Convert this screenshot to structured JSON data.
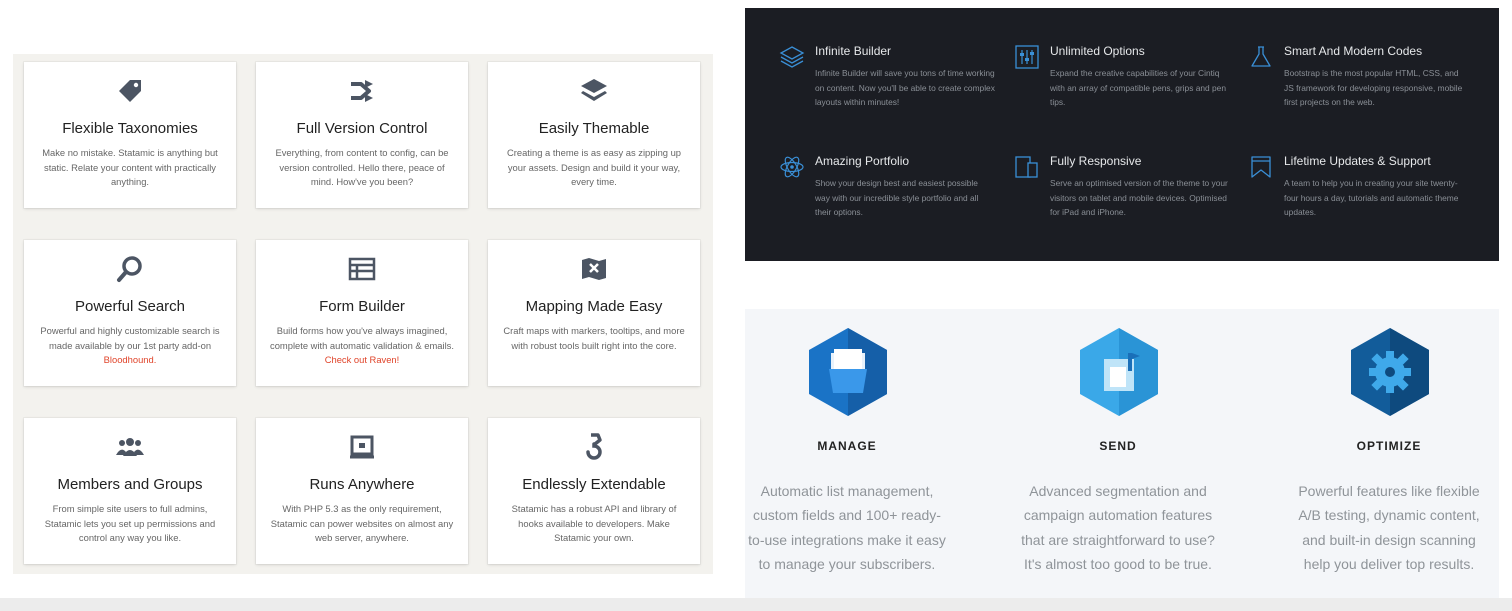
{
  "features_grid": [
    {
      "title": "Flexible Taxonomies",
      "desc": "Make no mistake. Statamic is anything but static. Relate your content with practically anything.",
      "link": "",
      "icon": "tag-icon"
    },
    {
      "title": "Full Version Control",
      "desc": "Everything, from content to config, can be version controlled. Hello there, peace of mind. How've you been?",
      "link": "",
      "icon": "branch-icon"
    },
    {
      "title": "Easily Themable",
      "desc": "Creating a theme is as easy as zipping up your assets. Design and build it your way, every time.",
      "link": "",
      "icon": "layers-icon"
    },
    {
      "title": "Powerful Search",
      "desc": "Powerful and highly customizable search is made available by our 1st party add-on",
      "link": "Bloodhound.",
      "icon": "search-icon"
    },
    {
      "title": "Form Builder",
      "desc": "Build forms how you've always imagined, complete with automatic validation & emails.",
      "link": "Check out Raven!",
      "icon": "form-icon"
    },
    {
      "title": "Mapping Made Easy",
      "desc": "Craft maps with markers, tooltips, and more with robust tools built right into the core.",
      "link": "",
      "icon": "map-icon"
    },
    {
      "title": "Members and Groups",
      "desc": "From simple site users to full admins, Statamic lets you set up permissions and control any way you like.",
      "link": "",
      "icon": "users-icon"
    },
    {
      "title": "Runs Anywhere",
      "desc": "With PHP 5.3 as the only requirement, Statamic can power websites on almost any web server, anywhere.",
      "link": "",
      "icon": "server-icon"
    },
    {
      "title": "Endlessly Extendable",
      "desc": "Statamic has a robust API and library of hooks available to developers. Make Statamic your own.",
      "link": "",
      "icon": "hook-icon"
    }
  ],
  "dark_features": [
    {
      "title": "Infinite Builder",
      "desc": "Infinite Builder will save you tons of time working on content. Now you'll be able to create complex layouts within minutes!",
      "icon": "stack-icon"
    },
    {
      "title": "Unlimited Options",
      "desc": "Expand the creative capabilities of your Cintiq with an array of compatible pens, grips and pen tips.",
      "icon": "sliders-icon"
    },
    {
      "title": "Smart And Modern Codes",
      "desc": "Bootstrap is the most popular HTML, CSS, and JS framework for developing responsive, mobile first projects on the web.",
      "icon": "flask-icon"
    },
    {
      "title": "Amazing Portfolio",
      "desc": "Show your design best and easiest possible way with our incredible style portfolio and all their options.",
      "icon": "atom-icon"
    },
    {
      "title": "Fully Responsive",
      "desc": "Serve an optimised version of the theme to your visitors on tablet and mobile devices. Optimised for iPad and iPhone.",
      "icon": "devices-icon"
    },
    {
      "title": "Lifetime Updates & Support",
      "desc": "A team to help you in creating your site twenty-four hours a day, tutorials and automatic theme updates.",
      "icon": "bookmark-icon"
    }
  ],
  "services": [
    {
      "heading": "MANAGE",
      "body": "Automatic list management, custom fields and 100+ ready-to-use integrations make it easy to manage your subscribers.",
      "icon": "folder-hex-icon"
    },
    {
      "heading": "SEND",
      "body": "Advanced segmentation and campaign automation features that are straightforward to use? It's almost too good to be true.",
      "icon": "mailbox-hex-icon"
    },
    {
      "heading": "OPTIMIZE",
      "body": "Powerful features like flexible A/B testing, dynamic content, and built-in design scanning help you deliver top results.",
      "icon": "gear-hex-icon"
    }
  ],
  "colors": {
    "accent_link": "#e0442a",
    "dark_bg": "#1b1d23",
    "icon_blue": "#3a8fd6",
    "hex_blue": "#1a73c6"
  }
}
